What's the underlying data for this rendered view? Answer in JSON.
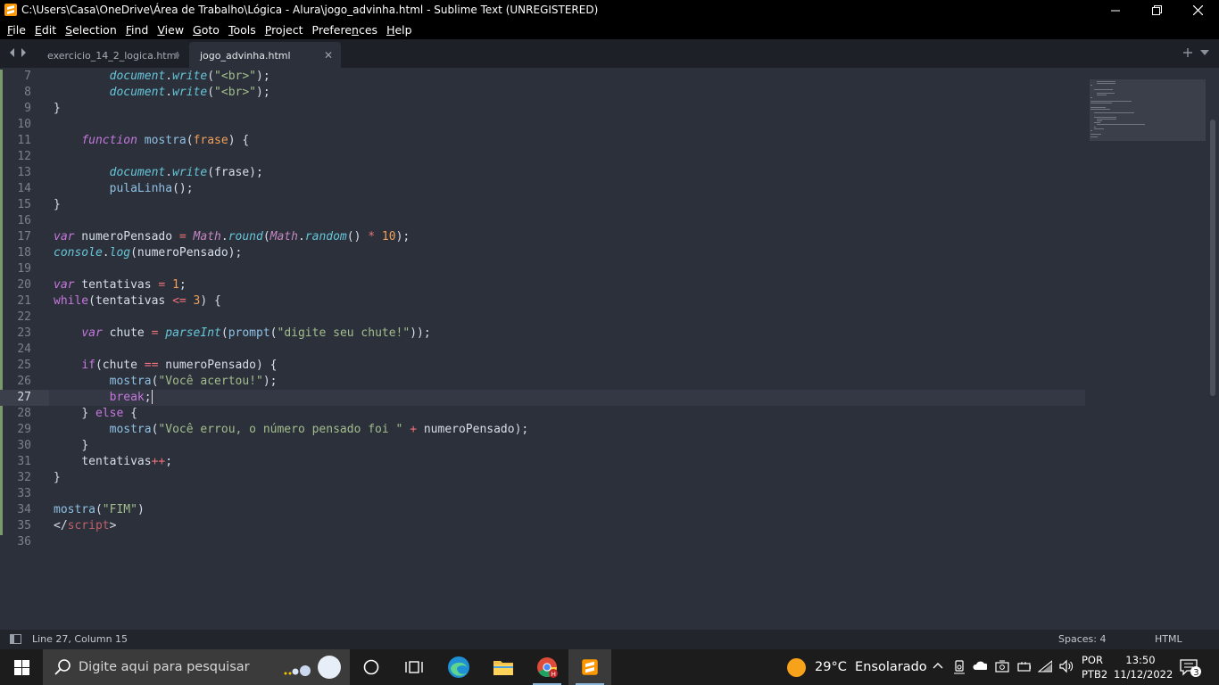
{
  "window": {
    "title": "C:\\Users\\Casa\\OneDrive\\Área de Trabalho\\Lógica - Alura\\jogo_advinha.html - Sublime Text (UNREGISTERED)"
  },
  "menu": [
    {
      "u": "F",
      "rest": "ile"
    },
    {
      "u": "E",
      "rest": "dit"
    },
    {
      "u": "S",
      "rest": "election"
    },
    {
      "u": "F",
      "rest": "ind"
    },
    {
      "u": "V",
      "rest": "iew"
    },
    {
      "u": "G",
      "rest": "oto"
    },
    {
      "u": "T",
      "rest": "ools"
    },
    {
      "u": "P",
      "rest": "roject"
    },
    {
      "pre": "Prefere",
      "u": "n",
      "rest": "ces"
    },
    {
      "u": "H",
      "rest": "elp"
    }
  ],
  "tabs": {
    "inactive": {
      "label": "exercicio_14_2_logica.html"
    },
    "active": {
      "label": "jogo_advinha.html"
    }
  },
  "editor": {
    "current_line": 27,
    "lines": [
      {
        "n": "7",
        "tokens": [
          [
            "",
            "        "
          ],
          [
            "fn",
            "document"
          ],
          [
            "pun",
            "."
          ],
          [
            "fn",
            "write"
          ],
          [
            "pun",
            "("
          ],
          [
            "str",
            "\"<br>\""
          ],
          [
            "pun",
            ");"
          ]
        ]
      },
      {
        "n": "8",
        "tokens": [
          [
            "",
            "        "
          ],
          [
            "fn",
            "document"
          ],
          [
            "pun",
            "."
          ],
          [
            "fn",
            "write"
          ],
          [
            "pun",
            "("
          ],
          [
            "str",
            "\"<br>\""
          ],
          [
            "pun",
            ");"
          ]
        ]
      },
      {
        "n": "9",
        "tokens": [
          [
            "pun",
            "}"
          ]
        ]
      },
      {
        "n": "10",
        "tokens": []
      },
      {
        "n": "11",
        "tokens": [
          [
            "",
            "    "
          ],
          [
            "kw",
            "function"
          ],
          [
            "",
            " "
          ],
          [
            "def",
            "mostra"
          ],
          [
            "pun",
            "("
          ],
          [
            "prm",
            "frase"
          ],
          [
            "pun",
            ") {"
          ]
        ]
      },
      {
        "n": "12",
        "tokens": []
      },
      {
        "n": "13",
        "tokens": [
          [
            "",
            "        "
          ],
          [
            "fn",
            "document"
          ],
          [
            "pun",
            "."
          ],
          [
            "fn",
            "write"
          ],
          [
            "pun",
            "(frase);"
          ]
        ]
      },
      {
        "n": "14",
        "tokens": [
          [
            "",
            "        "
          ],
          [
            "fnc",
            "pulaLinha"
          ],
          [
            "pun",
            "();"
          ]
        ]
      },
      {
        "n": "15",
        "tokens": [
          [
            "pun",
            "}"
          ]
        ]
      },
      {
        "n": "16",
        "tokens": []
      },
      {
        "n": "17",
        "tokens": [
          [
            "kw",
            "var"
          ],
          [
            "pun",
            " numeroPensado "
          ],
          [
            "op",
            "="
          ],
          [
            "pun",
            " "
          ],
          [
            "cls",
            "Math"
          ],
          [
            "pun",
            "."
          ],
          [
            "fn",
            "round"
          ],
          [
            "pun",
            "("
          ],
          [
            "cls",
            "Math"
          ],
          [
            "pun",
            "."
          ],
          [
            "fn",
            "random"
          ],
          [
            "pun",
            "() "
          ],
          [
            "op",
            "*"
          ],
          [
            "pun",
            " "
          ],
          [
            "num",
            "10"
          ],
          [
            "pun",
            ");"
          ]
        ]
      },
      {
        "n": "18",
        "tokens": [
          [
            "fn",
            "console"
          ],
          [
            "pun",
            "."
          ],
          [
            "fn",
            "log"
          ],
          [
            "pun",
            "(numeroPensado);"
          ]
        ]
      },
      {
        "n": "19",
        "tokens": []
      },
      {
        "n": "20",
        "tokens": [
          [
            "kw",
            "var"
          ],
          [
            "pun",
            " tentativas "
          ],
          [
            "op",
            "="
          ],
          [
            "pun",
            " "
          ],
          [
            "num",
            "1"
          ],
          [
            "pun",
            ";"
          ]
        ]
      },
      {
        "n": "21",
        "tokens": [
          [
            "kwi",
            "while"
          ],
          [
            "pun",
            "(tentativas "
          ],
          [
            "op",
            "<="
          ],
          [
            "pun",
            " "
          ],
          [
            "num",
            "3"
          ],
          [
            "pun",
            ") {"
          ]
        ]
      },
      {
        "n": "22",
        "tokens": []
      },
      {
        "n": "23",
        "tokens": [
          [
            "",
            "    "
          ],
          [
            "kw",
            "var"
          ],
          [
            "pun",
            " chute "
          ],
          [
            "op",
            "="
          ],
          [
            "pun",
            " "
          ],
          [
            "fn",
            "parseInt"
          ],
          [
            "pun",
            "("
          ],
          [
            "fnc",
            "prompt"
          ],
          [
            "pun",
            "("
          ],
          [
            "str",
            "\"digite seu chute!\""
          ],
          [
            "pun",
            "));"
          ]
        ]
      },
      {
        "n": "24",
        "tokens": []
      },
      {
        "n": "25",
        "tokens": [
          [
            "",
            "    "
          ],
          [
            "kwi",
            "if"
          ],
          [
            "pun",
            "(chute "
          ],
          [
            "op",
            "=="
          ],
          [
            "pun",
            " numeroPensado) {"
          ]
        ]
      },
      {
        "n": "26",
        "tokens": [
          [
            "",
            "        "
          ],
          [
            "fnc",
            "mostra"
          ],
          [
            "pun",
            "("
          ],
          [
            "str",
            "\"Você acertou!\""
          ],
          [
            "pun",
            ");"
          ]
        ]
      },
      {
        "n": "27",
        "tokens": [
          [
            "",
            "        "
          ],
          [
            "kwi",
            "break"
          ],
          [
            "pun",
            ";"
          ]
        ]
      },
      {
        "n": "28",
        "tokens": [
          [
            "",
            "    "
          ],
          [
            "pun",
            "} "
          ],
          [
            "kwi",
            "else"
          ],
          [
            "pun",
            " {"
          ]
        ]
      },
      {
        "n": "29",
        "tokens": [
          [
            "",
            "        "
          ],
          [
            "fnc",
            "mostra"
          ],
          [
            "pun",
            "("
          ],
          [
            "str",
            "\"Você errou, o número pensado foi \""
          ],
          [
            "pun",
            " "
          ],
          [
            "op",
            "+"
          ],
          [
            "pun",
            " numeroPensado);"
          ]
        ]
      },
      {
        "n": "30",
        "tokens": [
          [
            "",
            "    "
          ],
          [
            "pun",
            "}"
          ]
        ]
      },
      {
        "n": "31",
        "tokens": [
          [
            "",
            "    "
          ],
          [
            "pun",
            "tentativas"
          ],
          [
            "op",
            "++"
          ],
          [
            "pun",
            ";"
          ]
        ]
      },
      {
        "n": "32",
        "tokens": [
          [
            "pun",
            "}"
          ]
        ]
      },
      {
        "n": "33",
        "tokens": []
      },
      {
        "n": "34",
        "tokens": [
          [
            "fnc",
            "mostra"
          ],
          [
            "pun",
            "("
          ],
          [
            "str",
            "\"FIM\""
          ],
          [
            "pun",
            ")"
          ]
        ]
      },
      {
        "n": "35",
        "tokens": [
          [
            "pun",
            "</"
          ],
          [
            "tag",
            "script"
          ],
          [
            "pun",
            ">"
          ]
        ]
      },
      {
        "n": "36",
        "tokens": []
      }
    ]
  },
  "status": {
    "position": "Line 27, Column 15",
    "indent": "Spaces: 4",
    "syntax": "HTML"
  },
  "taskbar": {
    "search_placeholder": "Digite aqui para pesquisar",
    "weather": "29°C  Ensolarado",
    "lang_top": "POR",
    "lang_bottom": "PTB2",
    "time": "13:50",
    "date": "11/12/2022",
    "notifications": "3",
    "apps": [
      "task-view",
      "edge",
      "file-explorer",
      "chrome",
      "sublime-text"
    ]
  },
  "colors": {
    "editor_bg": "#2b303b",
    "tab_bar_bg": "#1d2026",
    "keyword": "#c678dd",
    "string": "#a3be8c",
    "number": "#f0a05a",
    "function": "#66c6d8",
    "operator": "#f07178"
  }
}
